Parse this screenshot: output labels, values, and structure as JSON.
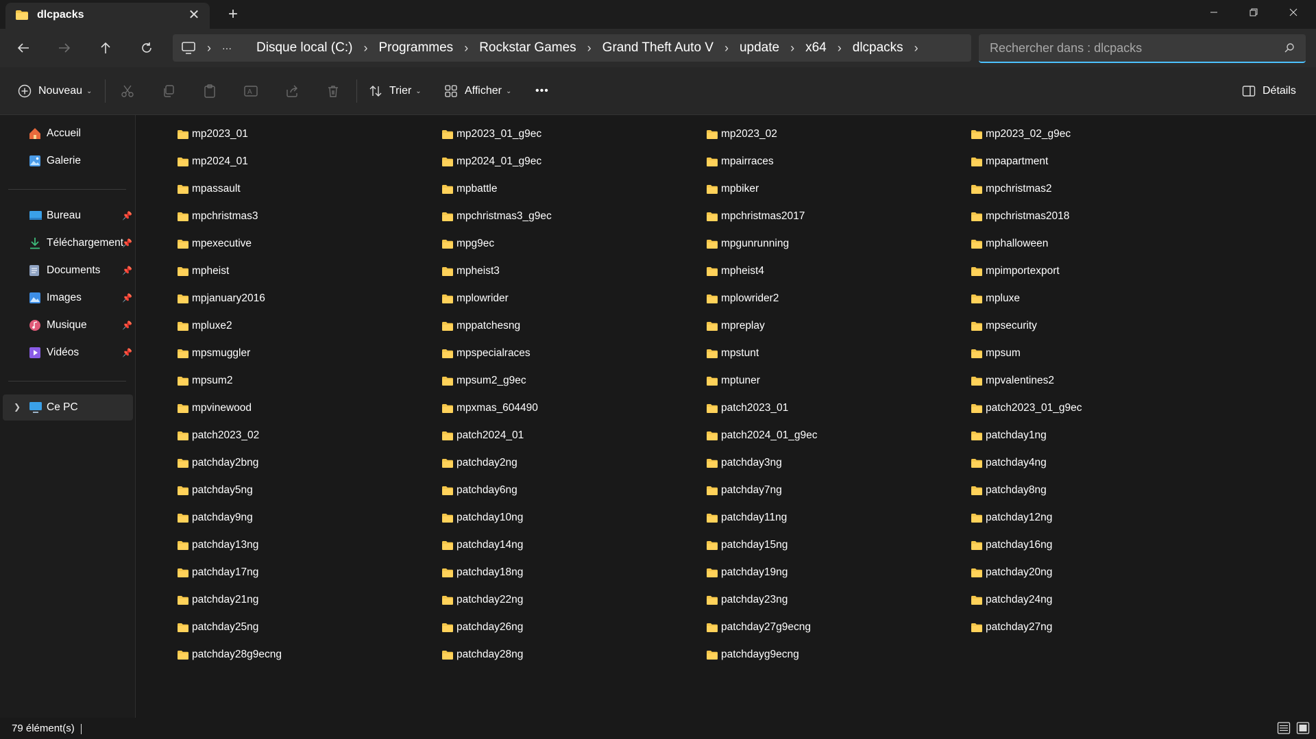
{
  "window": {
    "tab_title": "dlcpacks",
    "close_tab": "✕",
    "new_tab": "+"
  },
  "breadcrumb": {
    "items": [
      "Disque local (C:)",
      "Programmes",
      "Rockstar Games",
      "Grand Theft Auto V",
      "update",
      "x64",
      "dlcpacks"
    ],
    "ellipsis": "···"
  },
  "search": {
    "placeholder": "Rechercher dans : dlcpacks"
  },
  "toolbar": {
    "new_label": "Nouveau",
    "sort_label": "Trier",
    "view_label": "Afficher",
    "more_label": "•••",
    "details_label": "Détails"
  },
  "sidebar": {
    "items": [
      {
        "label": "Accueil",
        "icon": "home-icon"
      },
      {
        "label": "Galerie",
        "icon": "gallery-icon"
      },
      {
        "label": "Bureau",
        "icon": "desktop-icon",
        "pinned": true
      },
      {
        "label": "Téléchargement",
        "icon": "download-icon",
        "pinned": true
      },
      {
        "label": "Documents",
        "icon": "documents-icon",
        "pinned": true
      },
      {
        "label": "Images",
        "icon": "images-icon",
        "pinned": true
      },
      {
        "label": "Musique",
        "icon": "music-icon",
        "pinned": true
      },
      {
        "label": "Vidéos",
        "icon": "videos-icon",
        "pinned": true
      },
      {
        "label": "Ce PC",
        "icon": "pc-icon"
      }
    ]
  },
  "files": [
    "mp2023_01",
    "mp2023_01_g9ec",
    "mp2023_02",
    "mp2023_02_g9ec",
    "mp2024_01",
    "mp2024_01_g9ec",
    "mpairraces",
    "mpapartment",
    "mpassault",
    "mpbattle",
    "mpbiker",
    "mpchristmas2",
    "mpchristmas3",
    "mpchristmas3_g9ec",
    "mpchristmas2017",
    "mpchristmas2018",
    "mpexecutive",
    "mpg9ec",
    "mpgunrunning",
    "mphalloween",
    "mpheist",
    "mpheist3",
    "mpheist4",
    "mpimportexport",
    "mpjanuary2016",
    "mplowrider",
    "mplowrider2",
    "mpluxe",
    "mpluxe2",
    "mppatchesng",
    "mpreplay",
    "mpsecurity",
    "mpsmuggler",
    "mpspecialraces",
    "mpstunt",
    "mpsum",
    "mpsum2",
    "mpsum2_g9ec",
    "mptuner",
    "mpvalentines2",
    "mpvinewood",
    "mpxmas_604490",
    "patch2023_01",
    "patch2023_01_g9ec",
    "patch2023_02",
    "patch2024_01",
    "patch2024_01_g9ec",
    "patchday1ng",
    "patchday2bng",
    "patchday2ng",
    "patchday3ng",
    "patchday4ng",
    "patchday5ng",
    "patchday6ng",
    "patchday7ng",
    "patchday8ng",
    "patchday9ng",
    "patchday10ng",
    "patchday11ng",
    "patchday12ng",
    "patchday13ng",
    "patchday14ng",
    "patchday15ng",
    "patchday16ng",
    "patchday17ng",
    "patchday18ng",
    "patchday19ng",
    "patchday20ng",
    "patchday21ng",
    "patchday22ng",
    "patchday23ng",
    "patchday24ng",
    "patchday25ng",
    "patchday26ng",
    "patchday27g9ecng",
    "patchday27ng",
    "patchday28g9ecng",
    "patchday28ng",
    "patchdayg9ecng"
  ],
  "status": {
    "count": "79 élément(s)"
  },
  "colors": {
    "folder": "#f4c64a",
    "accent": "#4cc2ff",
    "background": "#191919"
  }
}
